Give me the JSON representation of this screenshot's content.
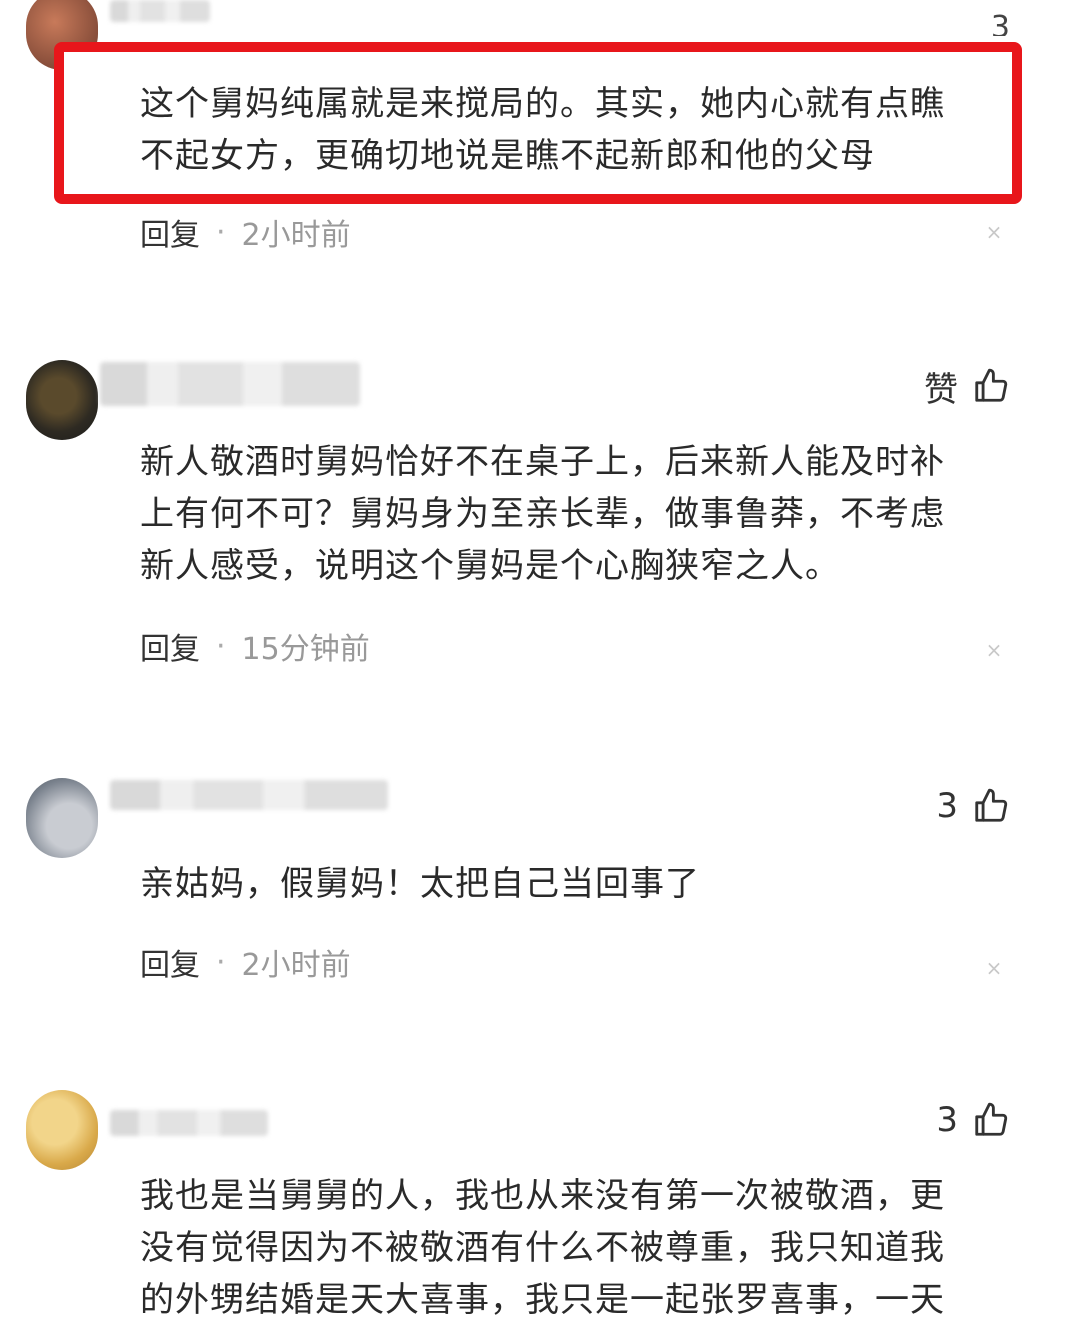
{
  "comments": [
    {
      "text_lines": [
        "这个舅妈纯属就是来搅局的。其实，她内心就有点瞧",
        "不起女方，更确切地说是瞧不起新郎和他的父母"
      ],
      "reply_label": "回复",
      "time": "2小时前",
      "likes": "3",
      "highlighted": true
    },
    {
      "text_lines": [
        "新人敬酒时舅妈恰好不在桌子上，后来新人能及时补",
        "上有何不可？舅妈身为至亲长辈，做事鲁莽，不考虑",
        "新人感受，说明这个舅妈是个心胸狭窄之人。"
      ],
      "reply_label": "回复",
      "time": "15分钟前",
      "like_label": "赞"
    },
    {
      "text_lines": [
        "亲姑妈，假舅妈！太把自己当回事了"
      ],
      "reply_label": "回复",
      "time": "2小时前",
      "likes": "3"
    },
    {
      "text_lines": [
        "我也是当舅舅的人，我也从来没有第一次被敬酒，更",
        "没有觉得因为不被敬酒有什么不被尊重，我只知道我",
        "的外甥结婚是天大喜事，我只是一起张罗喜事，一天"
      ],
      "likes": "3"
    }
  ],
  "icons": {
    "like": "thumbs-up-icon",
    "dismiss": "close-icon"
  },
  "colors": {
    "highlight_border": "#e8161b",
    "meta_time": "#999999"
  }
}
